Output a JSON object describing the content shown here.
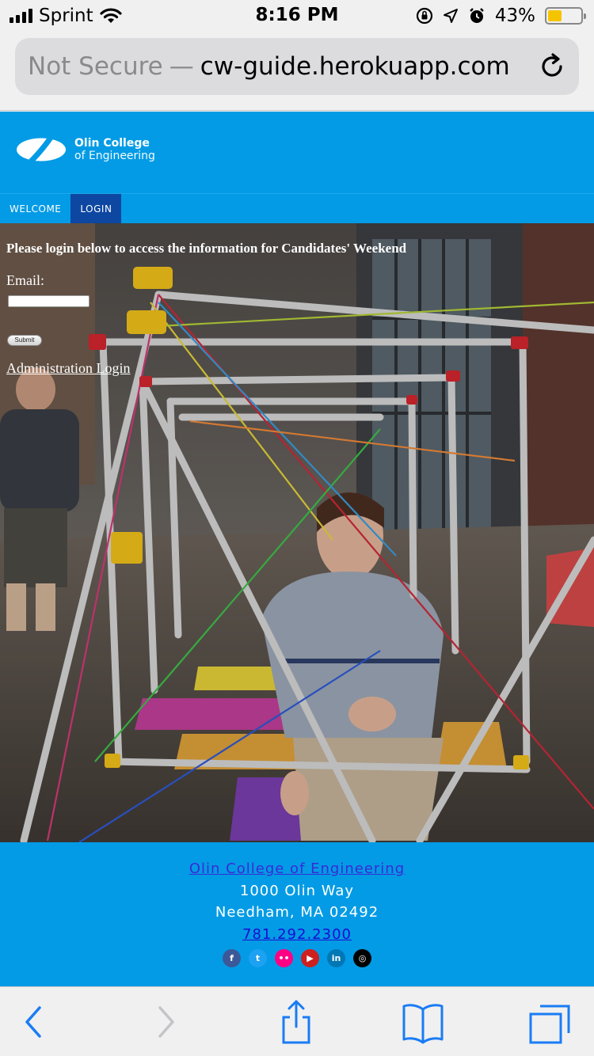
{
  "status_bar": {
    "carrier": "Sprint",
    "time": "8:16 PM",
    "battery_percent": "43%",
    "battery_level": 0.43,
    "battery_color": "#f5c400",
    "icons": [
      "signal-bars",
      "wifi",
      "orientation-lock",
      "location-arrow",
      "alarm-clock",
      "battery"
    ]
  },
  "url_bar": {
    "security_label": "Not Secure",
    "separator": "—",
    "host": "cw-guide.herokuapp.com",
    "reload_icon": "reload"
  },
  "site": {
    "brand_color": "#039be5",
    "active_nav_color": "#0d47a1",
    "logo": {
      "line1": "Olin College",
      "line2": "of Engineering"
    },
    "nav": [
      {
        "label": "WELCOME",
        "active": false
      },
      {
        "label": "LOGIN",
        "active": true
      }
    ]
  },
  "login": {
    "heading": "Please login below to access the information for Candidates' Weekend",
    "email_label": "Email:",
    "email_value": "",
    "submit_label": "Submit",
    "admin_link": "Administration Login"
  },
  "footer": {
    "college_link": "Olin College of Engineering",
    "address_line1": "1000 Olin Way",
    "address_line2": "Needham, MA 02492",
    "phone": "781.292.2300",
    "social": [
      {
        "name": "facebook",
        "glyph": "f",
        "color": "#3b5998"
      },
      {
        "name": "twitter",
        "glyph": "t",
        "color": "#1da1f2"
      },
      {
        "name": "flickr",
        "glyph": "••",
        "color": "#ff0084"
      },
      {
        "name": "youtube",
        "glyph": "▶",
        "color": "#cd201f"
      },
      {
        "name": "linkedin",
        "glyph": "in",
        "color": "#0077b5"
      },
      {
        "name": "instagram",
        "glyph": "◎",
        "color": "#000000"
      }
    ]
  },
  "toolbar": {
    "icons": [
      "back-chevron",
      "forward-chevron",
      "share",
      "bookmarks",
      "tabs"
    ],
    "tint_color": "#1a7cf5"
  }
}
